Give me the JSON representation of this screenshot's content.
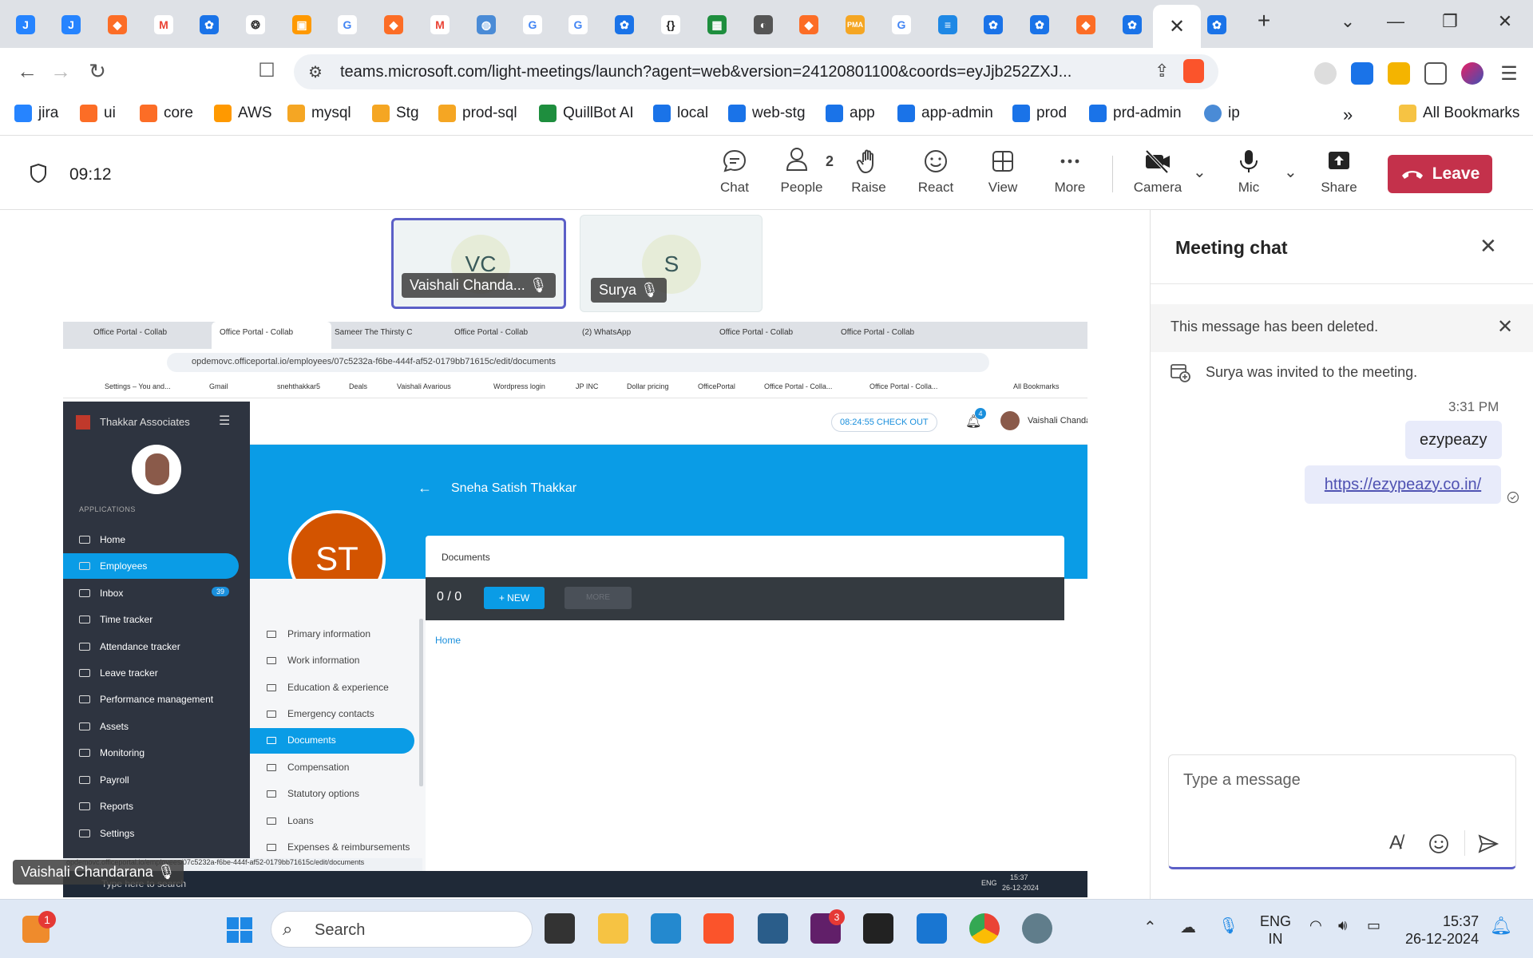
{
  "browser": {
    "url": "teams.microsoft.com/light-meetings/launch?agent=web&version=24120801100&coords=eyJjb252ZXJ...",
    "bookmarks": [
      "jira",
      "ui",
      "core",
      "AWS",
      "mysql",
      "Stg",
      "prod-sql",
      "QuillBot AI",
      "local",
      "web-stg",
      "app",
      "app-admin",
      "prod",
      "prd-admin",
      "ip"
    ],
    "all_bookmarks_label": "All Bookmarks",
    "overflow_icon": "double-chevron-right-icon"
  },
  "meeting": {
    "timer": "09:12",
    "buttons": {
      "chat": "Chat",
      "people": "People",
      "people_count": "2",
      "raise": "Raise",
      "react": "React",
      "view": "View",
      "more": "More",
      "camera": "Camera",
      "mic": "Mic",
      "share": "Share",
      "leave": "Leave"
    },
    "participants": [
      {
        "initials": "VC",
        "name": "Vaishali Chanda..."
      },
      {
        "initials": "S",
        "name": "Surya"
      }
    ],
    "presenter_label": "Vaishali Chandarana",
    "accent": "#5b5fc7",
    "leave_color": "#c4314b"
  },
  "shared_screen": {
    "tabs": [
      "Office Portal - Collab",
      "Office Portal - Collab",
      "Sameer The Thirsty C",
      "Office Portal - Collab",
      "(2) WhatsApp",
      "Office Portal - Collab",
      "Office Portal - Collab"
    ],
    "url": "opdemovc.officeportal.io/employees/07c5232a-f6be-444f-af52-0179bb71615c/edit/documents",
    "bookmarks": [
      "Settings – You and...",
      "Gmail",
      "snehthakkar5",
      "Deals",
      "Vaishali Avarious",
      "Wordpress login",
      "JP INC",
      "Dollar pricing",
      "OfficePortal",
      "Office Portal - Colla...",
      "Office Portal - Colla..."
    ],
    "all_bookmarks": "All Bookmarks",
    "company": "Thakkar Associates",
    "checkout": "08:24:55 CHECK OUT",
    "notif_count": "4",
    "user": "Vaishali Chandarana",
    "employee": "Sneha Satish Thakkar",
    "initials": "ST",
    "section_label": "APPLICATIONS",
    "menu": [
      "Home",
      "Employees",
      "Inbox",
      "Time tracker",
      "Attendance tracker",
      "Leave tracker",
      "Performance management",
      "Assets",
      "Monitoring",
      "Payroll",
      "Reports",
      "Settings"
    ],
    "inbox_count": "39",
    "submenu": [
      "Primary information",
      "Work information",
      "Education & experience",
      "Emergency contacts",
      "Documents",
      "Compensation",
      "Statutory options",
      "Loans",
      "Expenses & reimbursements"
    ],
    "documents_title": "Documents",
    "count": "0 / 0",
    "new_btn": "+ NEW",
    "more_btn": "MORE",
    "crumb": "Home",
    "status_url": "opdemovc.officeportal.io/employees/07c5232a-f6be-444f-af52-0179bb71615c/edit/documents",
    "search_placeholder": "Type here to search",
    "tray_lang": "ENG",
    "time": "15:37",
    "date": "26-12-2024"
  },
  "chat": {
    "title": "Meeting chat",
    "deleted_notice": "This message has been deleted.",
    "invite_notice": "Surya was invited to the meeting.",
    "time": "3:31 PM",
    "messages": [
      "ezypeazy",
      "https://ezypeazy.co.in/"
    ],
    "input_placeholder": "Type a message"
  },
  "taskbar": {
    "badge": "1",
    "search_placeholder": "Search",
    "slack_badge": "3",
    "lang1": "ENG",
    "lang2": "IN",
    "time": "15:37",
    "date": "26-12-2024"
  }
}
